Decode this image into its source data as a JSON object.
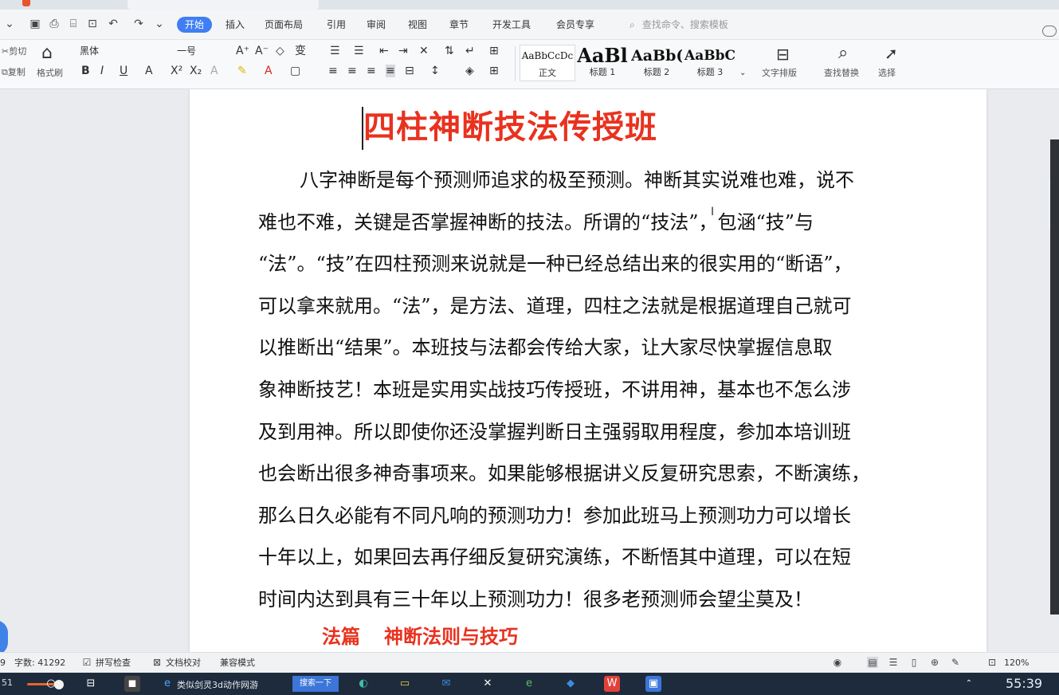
{
  "menu": {
    "tabs": [
      "开始",
      "插入",
      "页面布局",
      "引用",
      "审阅",
      "视图",
      "章节",
      "开发工具",
      "会员专享"
    ],
    "search_placeholder": "查找命令、搜索模板"
  },
  "ribbon": {
    "cut_label": "剪切",
    "copy_label": "复制",
    "format_painter_label": "格式刷",
    "font_name": "黑体",
    "font_size": "一号",
    "styles": [
      {
        "sample": "AaBbCcDc",
        "name": "正文"
      },
      {
        "sample": "AaBl",
        "name": "标题 1"
      },
      {
        "sample": "AaBb(",
        "name": "标题 2"
      },
      {
        "sample": "AaBbC",
        "name": "标题 3"
      }
    ],
    "text_layout_label": "文字排版",
    "find_replace_label": "查找替换",
    "select_label": "选择"
  },
  "document": {
    "title": "四柱神断技法传授班",
    "body_lines": [
      "八字神断是每个预测师追求的极至预测。神断其实说难也难，说不",
      "难也不难，关键是否掌握神断的技法。所谓的“技法”，包涵“技”与",
      "“法”。“技”在四柱预测来说就是一种已经总结出来的很实用的“断语”，",
      "可以拿来就用。“法”，是方法、道理，四柱之法就是根据道理自己就可",
      "以推断出“结果”。本班技与法都会传给大家，让大家尽快掌握信息取",
      "象神断技艺！本班是实用实战技巧传授班，不讲用神，基本也不怎么涉",
      "及到用神。所以即使你还没掌握判断日主强弱取用程度，参加本培训班",
      "也会断出很多神奇事项来。如果能够根据讲义反复研究思索，不断演练，",
      "那么日久必能有不同凡响的预测功力！参加此班马上预测功力可以增长",
      "十年以上，如果回去再仔细反复研究演练，不断悟其中道理，可以在短",
      "时间内达到具有三十年以上预测功力！很多老预测师会望尘莫及！"
    ],
    "section_heading_part1": "法篇",
    "section_heading_part2": "神断法则与技巧"
  },
  "status": {
    "page_fragment": "9",
    "word_count": "字数: 41292",
    "spell_check": "拼写检查",
    "doc_proof": "文档校对",
    "compat_mode": "兼容模式",
    "zoom": "120%"
  },
  "taskbar": {
    "time_fragment": "51",
    "browser_label": "类似剑灵3d动作网游",
    "search_button": "搜索一下",
    "clock": "55:39"
  },
  "colors": {
    "accent": "#3f7ef3",
    "title_red": "#e8321f",
    "taskbar": "#1e2b3c"
  }
}
